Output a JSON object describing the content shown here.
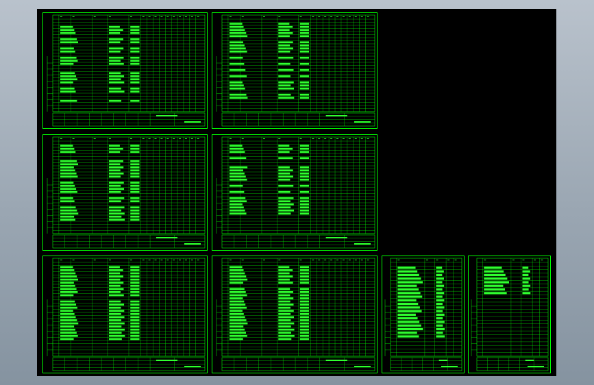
{
  "canvas": {
    "background": "#000000",
    "line_color": "#00ff00",
    "filled_color": "#2fff2f",
    "sheet_count": 8
  },
  "sheets": [
    {
      "id": "sheet-1",
      "kind": "large",
      "rows": 30,
      "title": "",
      "blocks": [
        2,
        3,
        4,
        6,
        7,
        9,
        10,
        12,
        13,
        14,
        17,
        18,
        19,
        20,
        22,
        23,
        26
      ]
    },
    {
      "id": "sheet-2",
      "kind": "large",
      "rows": 30,
      "title": "",
      "blocks": [
        1,
        2,
        3,
        4,
        5,
        7,
        8,
        9,
        10,
        12,
        14,
        16,
        18,
        20,
        21,
        22,
        24,
        25
      ]
    },
    {
      "id": "sheet-3",
      "kind": "large",
      "rows": 30,
      "title": "",
      "blocks": [
        1,
        2,
        3,
        6,
        7,
        8,
        9,
        10,
        11,
        13,
        14,
        15,
        16,
        18,
        19,
        21,
        22,
        23,
        24,
        25
      ]
    },
    {
      "id": "sheet-4",
      "kind": "large",
      "rows": 30,
      "title": "",
      "blocks": [
        1,
        2,
        3,
        5,
        8,
        9,
        10,
        11,
        12,
        14,
        16,
        18,
        19,
        20,
        21,
        22,
        23
      ]
    },
    {
      "id": "sheet-5",
      "kind": "large",
      "rows": 30,
      "title": "",
      "blocks": [
        1,
        2,
        3,
        4,
        5,
        6,
        7,
        8,
        9,
        10,
        12,
        13,
        14,
        15,
        16,
        17,
        18,
        19,
        20,
        21,
        22,
        23,
        24
      ]
    },
    {
      "id": "sheet-6",
      "kind": "large",
      "rows": 30,
      "title": "",
      "blocks": [
        1,
        2,
        3,
        4,
        5,
        6,
        8,
        9,
        10,
        11,
        12,
        13,
        14,
        15,
        16,
        17,
        18,
        19,
        20,
        21,
        22,
        23,
        24
      ]
    },
    {
      "id": "sheet-7",
      "kind": "small",
      "rows": 26,
      "title": "",
      "blocks": [
        1,
        2,
        3,
        4,
        5,
        6,
        7,
        8,
        9,
        10,
        11,
        12,
        13,
        14,
        15,
        16,
        17,
        18,
        19,
        20
      ]
    },
    {
      "id": "sheet-8",
      "kind": "small",
      "rows": 26,
      "title": "",
      "blocks": [
        1,
        2,
        3,
        4,
        5,
        6,
        7,
        8
      ]
    }
  ]
}
